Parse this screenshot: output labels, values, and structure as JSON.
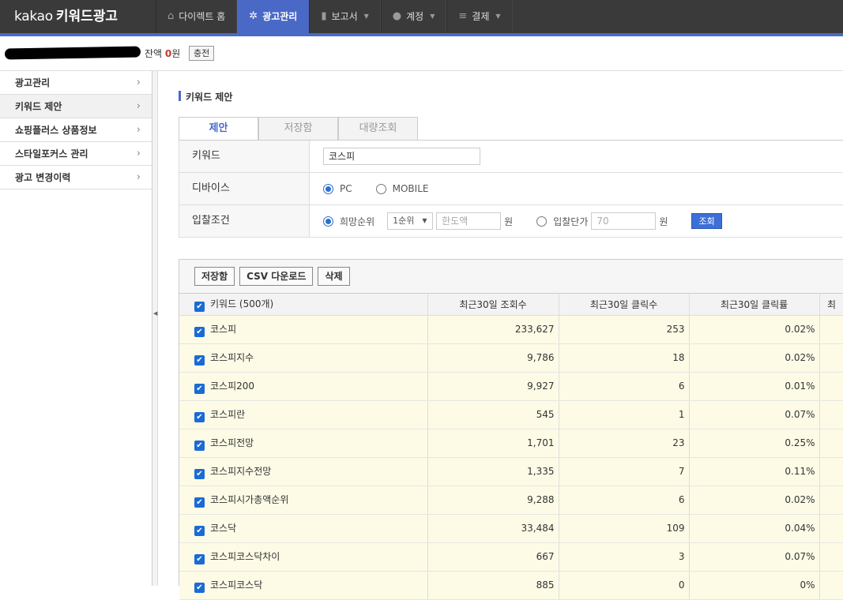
{
  "app": {
    "brand": "kakao",
    "product": "키워드광고"
  },
  "nav": [
    {
      "label": "다이렉트 홈",
      "icon": "home-icon",
      "active": false,
      "caret": false
    },
    {
      "label": "광고관리",
      "icon": "gear-icon",
      "active": true,
      "caret": false
    },
    {
      "label": "보고서",
      "icon": "bar-chart-icon",
      "active": false,
      "caret": true
    },
    {
      "label": "계정",
      "icon": "user-icon",
      "active": false,
      "caret": true
    },
    {
      "label": "결제",
      "icon": "database-icon",
      "active": false,
      "caret": true
    }
  ],
  "account": {
    "balance_label": "잔액",
    "balance_value": "0",
    "balance_unit": "원",
    "charge_label": "충전"
  },
  "sidebar": {
    "items": [
      {
        "label": "광고관리"
      },
      {
        "label": "키워드 제안"
      },
      {
        "label": "쇼핑플러스 상품정보"
      },
      {
        "label": "스타일포커스 관리"
      },
      {
        "label": "광고 변경이력"
      }
    ]
  },
  "main": {
    "title": "키워드 제안",
    "tabs": [
      {
        "label": "제안"
      },
      {
        "label": "저장함"
      },
      {
        "label": "대량조회"
      }
    ],
    "form": {
      "keyword_label": "키워드",
      "keyword_value": "코스피",
      "device_label": "디바이스",
      "device_pc": "PC",
      "device_mobile": "MOBILE",
      "bid_label": "입찰조건",
      "bid_rank_label": "희망순위",
      "bid_rank_value": "1순위",
      "bid_limit_placeholder": "한도액",
      "bid_unit": "원",
      "bid_price_label": "입찰단가",
      "bid_price_placeholder": "70",
      "bid_price_unit": "원",
      "search_label": "조회"
    },
    "toolbar": {
      "save": "저장함",
      "csv": "CSV 다운로드",
      "delete": "삭제"
    },
    "table": {
      "headers": [
        "키워드 (500개)",
        "최근30일 조회수",
        "최근30일 클릭수",
        "최근30일 클릭률",
        "최"
      ],
      "rows": [
        {
          "keyword": "코스피",
          "views": "233,627",
          "clicks": "253",
          "ctr": "0.02%"
        },
        {
          "keyword": "코스피지수",
          "views": "9,786",
          "clicks": "18",
          "ctr": "0.02%"
        },
        {
          "keyword": "코스피200",
          "views": "9,927",
          "clicks": "6",
          "ctr": "0.01%"
        },
        {
          "keyword": "코스피란",
          "views": "545",
          "clicks": "1",
          "ctr": "0.07%"
        },
        {
          "keyword": "코스피전망",
          "views": "1,701",
          "clicks": "23",
          "ctr": "0.25%"
        },
        {
          "keyword": "코스피지수전망",
          "views": "1,335",
          "clicks": "7",
          "ctr": "0.11%"
        },
        {
          "keyword": "코스피시가총액순위",
          "views": "9,288",
          "clicks": "6",
          "ctr": "0.02%"
        },
        {
          "keyword": "코스닥",
          "views": "33,484",
          "clicks": "109",
          "ctr": "0.04%"
        },
        {
          "keyword": "코스피코스닥차이",
          "views": "667",
          "clicks": "3",
          "ctr": "0.07%"
        },
        {
          "keyword": "코스피코스닥",
          "views": "885",
          "clicks": "0",
          "ctr": "0%"
        }
      ]
    }
  },
  "colors": {
    "topbar": "#3a3a3a",
    "accent": "#4a69c6",
    "row_highlight": "#fdfbe6",
    "checkbox": "#1a6bd6"
  }
}
